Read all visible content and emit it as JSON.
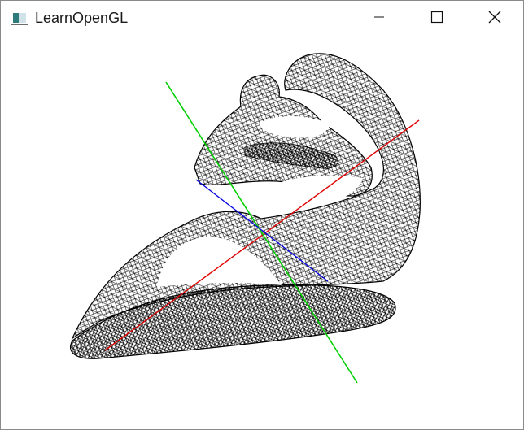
{
  "window": {
    "title": "LearnOpenGL",
    "icon": "opengl-app-icon",
    "controls": {
      "minimize_icon": "minimize-icon",
      "maximize_icon": "maximize-icon",
      "close_icon": "close-icon"
    }
  },
  "scene": {
    "render_mode": "wireframe",
    "background": "#ffffff",
    "mesh_color": "#000000",
    "axes": [
      {
        "name": "x",
        "color": "#e00000"
      },
      {
        "name": "y",
        "color": "#00d000"
      },
      {
        "name": "z",
        "color": "#0000e0"
      }
    ]
  }
}
